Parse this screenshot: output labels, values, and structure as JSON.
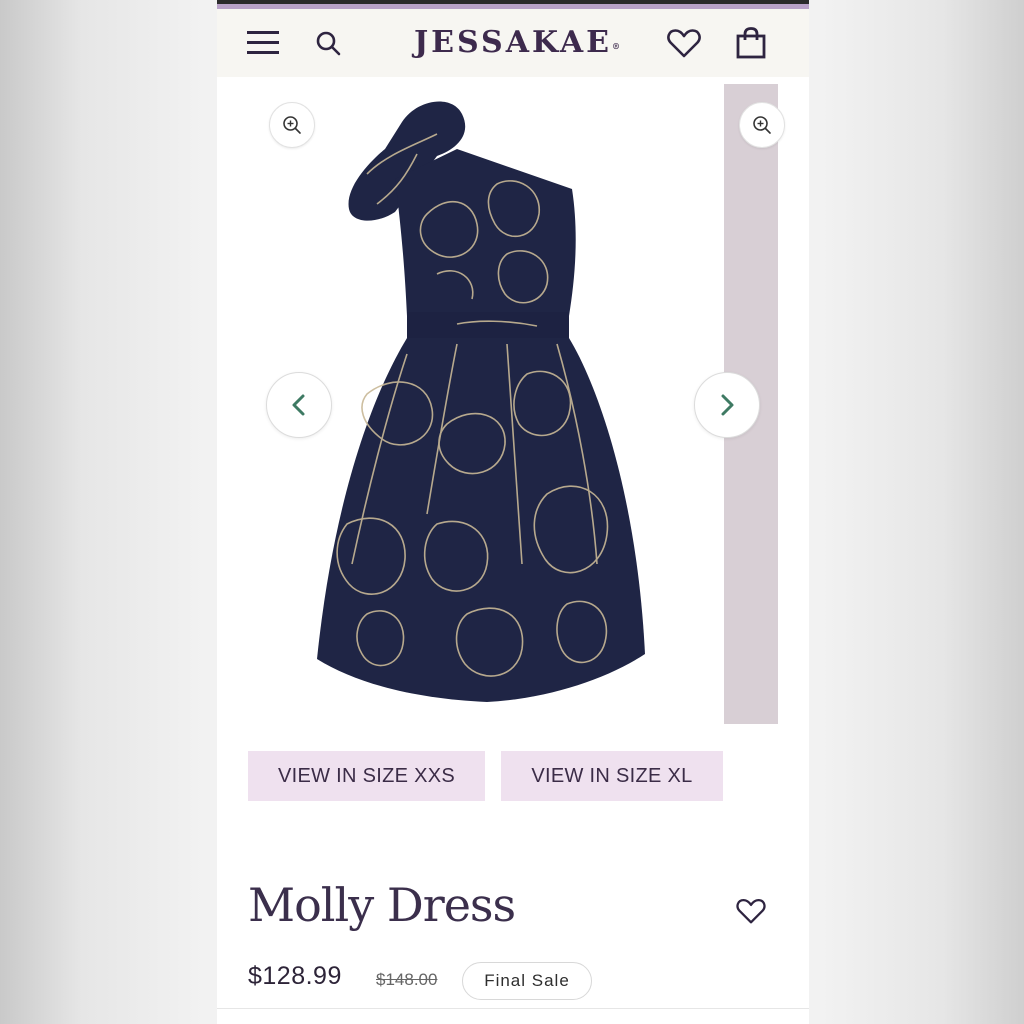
{
  "header": {
    "brand": "JESSAKAE",
    "trademark": "®",
    "icons": {
      "menu": "hamburger-menu-icon",
      "search": "search-icon",
      "wishlist": "heart-icon",
      "bag": "shopping-bag-icon"
    }
  },
  "gallery": {
    "zoom_icon": "zoom-in-icon",
    "prev_icon": "chevron-left-icon",
    "next_icon": "chevron-right-icon",
    "accent_color": "#3e7a63"
  },
  "size_buttons": [
    {
      "label": "VIEW IN SIZE XXS"
    },
    {
      "label": "VIEW IN SIZE XL"
    }
  ],
  "product": {
    "title": "Molly Dress",
    "price": "$128.99",
    "original_price": "$148.00",
    "badge": "Final Sale"
  },
  "colors": {
    "brand": "#3d2a4d",
    "accent_strip": "#b9a2c8",
    "size_button_bg": "#efe1ef",
    "dress_navy": "#1f2545",
    "dress_pattern": "#c8b896"
  }
}
